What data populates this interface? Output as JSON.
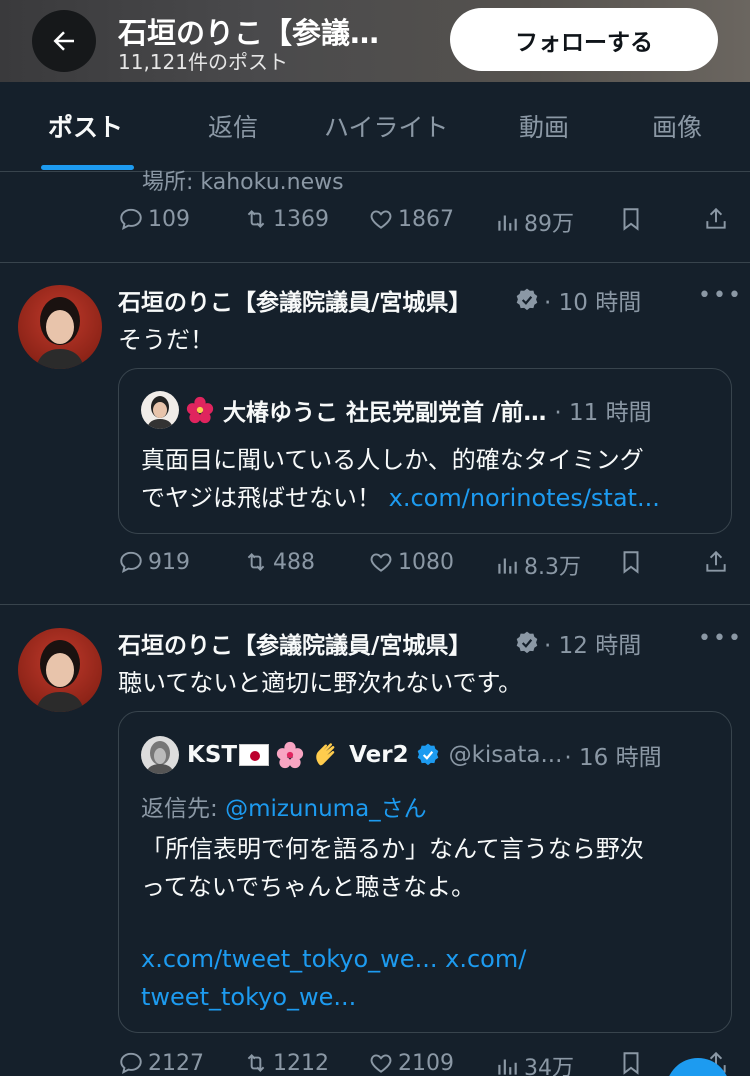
{
  "header": {
    "name": "石垣のりこ【参議…",
    "post_count": "11,121件のポスト",
    "follow_label": "フォローする"
  },
  "tabs": [
    {
      "label": "ポスト",
      "active": true
    },
    {
      "label": "返信"
    },
    {
      "label": "ハイライト"
    },
    {
      "label": "動画"
    },
    {
      "label": "画像"
    }
  ],
  "prev_post": {
    "partial_text": "場所: kahoku.news",
    "replies": "109",
    "reposts": "1369",
    "likes": "1867",
    "views": "89万"
  },
  "tweets": [
    {
      "author": "石垣のりこ【参議院議員/宮城県】",
      "time": "· 10 時間",
      "text": "そうだ！",
      "quote": {
        "author": "大椿ゆうこ 社民党副党首 /前…",
        "time": "· 11 時間",
        "lines": [
          "真面目に聞いている人しか、的確なタイミング",
          "でヤジは飛ばせない！"
        ],
        "link": "x.com/norinotes/stat..."
      },
      "replies": "919",
      "reposts": "488",
      "likes": "1080",
      "views": "8.3万"
    },
    {
      "author": "石垣のりこ【参議院議員/宮城県】",
      "time": "· 12 時間",
      "text": "聴いてないと適切に野次れないです。",
      "quote": {
        "author_prefix": "KST",
        "author_suffix": "Ver2",
        "handle": "@kisata...",
        "time": "· 16 時間",
        "reply_label": "返信先: ",
        "reply_to": "@mizunuma_さん",
        "lines": [
          "「所信表明で何を語るか」なんて言うなら野次",
          "ってないでちゃんと聴きなよ。"
        ],
        "link1": "x.com/tweet_tokyo_we...",
        "link2": "x.com/",
        "link3": "tweet_tokyo_we..."
      },
      "replies": "2127",
      "reposts": "1212",
      "likes": "2109",
      "views": "34万"
    }
  ],
  "icons": [
    "back-arrow-icon",
    "reply-icon",
    "repost-icon",
    "like-icon",
    "views-icon",
    "bookmark-icon",
    "share-icon",
    "verified-icon",
    "more-icon"
  ],
  "colors": {
    "background": "#15202b",
    "accent": "#1d9bf0",
    "muted": "#8b98a5",
    "border": "#38444d"
  }
}
